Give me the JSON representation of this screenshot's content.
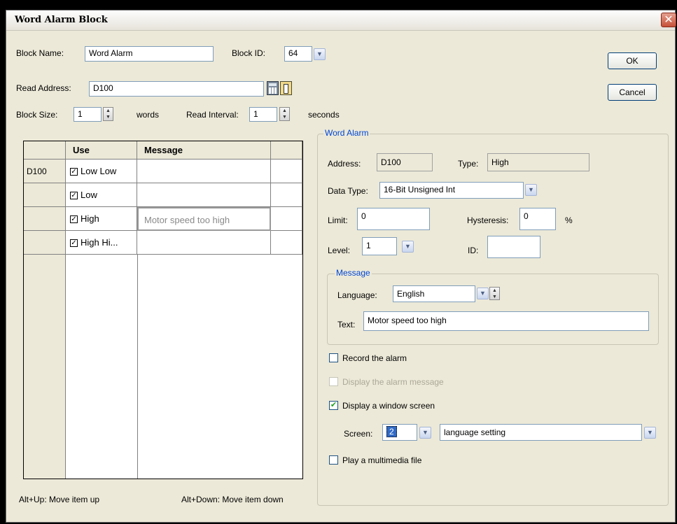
{
  "window": {
    "title": "Word Alarm Block",
    "close_glyph": "✕"
  },
  "top": {
    "block_name_label": "Block Name:",
    "block_name_value": "Word Alarm",
    "block_id_label": "Block ID:",
    "block_id_value": "64",
    "read_address_label": "Read Address:",
    "read_address_value": "D100",
    "block_size_label": "Block Size:",
    "block_size_value": "1",
    "words_label": "words",
    "read_interval_label": "Read Interval:",
    "read_interval_value": "1",
    "seconds_label": "seconds"
  },
  "buttons": {
    "ok": "OK",
    "cancel": "Cancel"
  },
  "grid": {
    "headers": {
      "use": "Use",
      "message": "Message"
    },
    "rows": [
      {
        "address": "D100",
        "use": "Low Low",
        "checked": true,
        "message": ""
      },
      {
        "address": "",
        "use": "Low",
        "checked": true,
        "message": ""
      },
      {
        "address": "",
        "use": "High",
        "checked": true,
        "message": "Motor speed too high"
      },
      {
        "address": "",
        "use": "High Hi...",
        "checked": true,
        "message": ""
      }
    ],
    "hint_up": "Alt+Up: Move item up",
    "hint_down": "Alt+Down: Move item down"
  },
  "word_alarm": {
    "group_label": "Word Alarm",
    "address_label": "Address:",
    "address_value": "D100",
    "type_label": "Type:",
    "type_value": "High",
    "data_type_label": "Data Type:",
    "data_type_value": "16-Bit Unsigned Int",
    "limit_label": "Limit:",
    "limit_value": "0",
    "hysteresis_label": "Hysteresis:",
    "hysteresis_value": "0",
    "hysteresis_unit": "%",
    "level_label": "Level:",
    "level_value": "1",
    "id_label": "ID:",
    "id_value": "",
    "message": {
      "group_label": "Message",
      "language_label": "Language:",
      "language_value": "English",
      "text_label": "Text:",
      "text_value": "Motor speed too high"
    },
    "record_alarm": {
      "label": "Record the alarm",
      "checked": false
    },
    "display_message": {
      "label": "Display the alarm message",
      "checked": false,
      "disabled": true
    },
    "display_window": {
      "label": "Display a window screen",
      "checked": true
    },
    "screen_label": "Screen:",
    "screen_number": "2",
    "screen_name": "language setting",
    "play_multimedia": {
      "label": "Play a multimedia file",
      "checked": false
    }
  },
  "icons": {
    "calculator": "calculator-icon",
    "address-picker": "address-picker-icon",
    "dropdown": "chevron-down-icon",
    "spin": "spin-updown-icon",
    "check": "checkmark-icon"
  },
  "glyphs": {
    "dropdown": "▼",
    "check": "✔",
    "grid_check": "✓",
    "spin_up": "▲",
    "spin_down": "▼"
  }
}
